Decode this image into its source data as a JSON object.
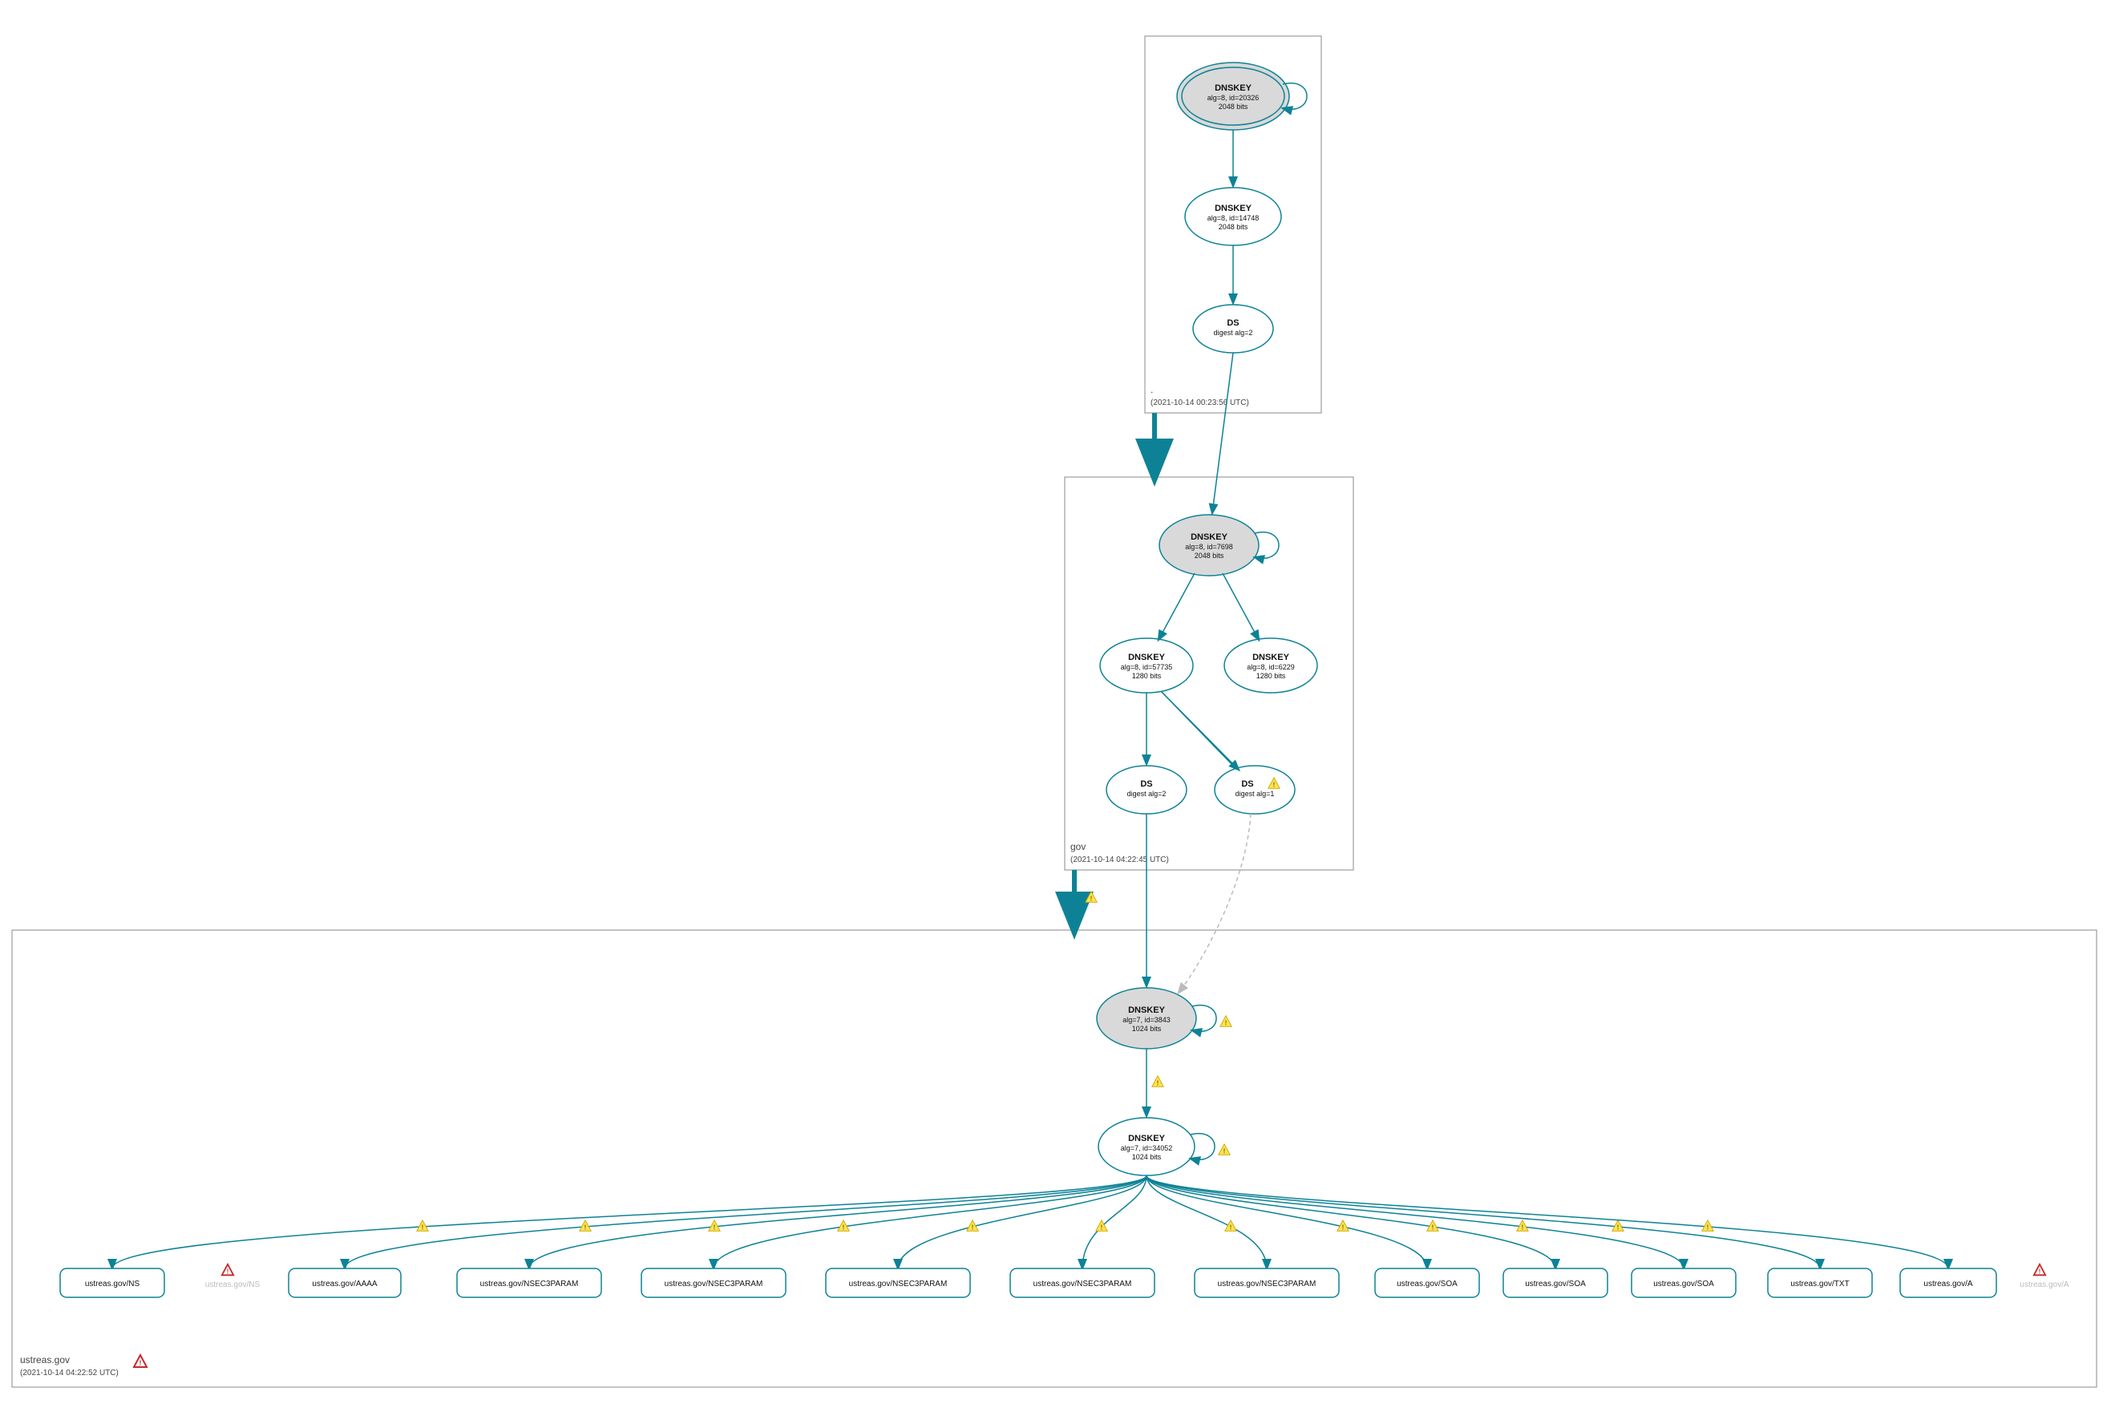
{
  "zones": {
    "root": {
      "label": ".",
      "timestamp": "(2021-10-14 00:23:56 UTC)",
      "ksk": {
        "title": "DNSKEY",
        "sub1": "alg=8, id=20326",
        "sub2": "2048 bits"
      },
      "zsk": {
        "title": "DNSKEY",
        "sub1": "alg=8, id=14748",
        "sub2": "2048 bits"
      },
      "ds": {
        "title": "DS",
        "sub1": "digest alg=2"
      }
    },
    "gov": {
      "label": "gov",
      "timestamp": "(2021-10-14 04:22:45 UTC)",
      "ksk": {
        "title": "DNSKEY",
        "sub1": "alg=8, id=7698",
        "sub2": "2048 bits"
      },
      "zsk1": {
        "title": "DNSKEY",
        "sub1": "alg=8, id=57735",
        "sub2": "1280 bits"
      },
      "zsk2": {
        "title": "DNSKEY",
        "sub1": "alg=8, id=6229",
        "sub2": "1280 bits"
      },
      "ds1": {
        "title": "DS",
        "sub1": "digest alg=2"
      },
      "ds2": {
        "title": "DS",
        "sub1": "digest alg=1"
      }
    },
    "ustreas": {
      "label": "ustreas.gov",
      "timestamp": "(2021-10-14 04:22:52 UTC)",
      "ksk": {
        "title": "DNSKEY",
        "sub1": "alg=7, id=3843",
        "sub2": "1024 bits"
      },
      "zsk": {
        "title": "DNSKEY",
        "sub1": "alg=7, id=34052",
        "sub2": "1024 bits"
      }
    }
  },
  "rrsets": [
    {
      "label": "ustreas.gov/NS"
    },
    {
      "label": "ustreas.gov/AAAA"
    },
    {
      "label": "ustreas.gov/NSEC3PARAM"
    },
    {
      "label": "ustreas.gov/NSEC3PARAM"
    },
    {
      "label": "ustreas.gov/NSEC3PARAM"
    },
    {
      "label": "ustreas.gov/NSEC3PARAM"
    },
    {
      "label": "ustreas.gov/NSEC3PARAM"
    },
    {
      "label": "ustreas.gov/SOA"
    },
    {
      "label": "ustreas.gov/SOA"
    },
    {
      "label": "ustreas.gov/SOA"
    },
    {
      "label": "ustreas.gov/TXT"
    },
    {
      "label": "ustreas.gov/A"
    }
  ],
  "dim_rrsets": {
    "ns": "ustreas.gov/NS",
    "a": "ustreas.gov/A"
  }
}
